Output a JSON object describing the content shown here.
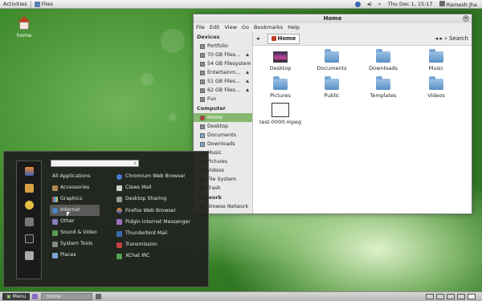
{
  "top_panel": {
    "activities": "Activities",
    "app_label": "Files",
    "clock": "Thu Dec  1, 15:17",
    "user": "Ramesh Jha"
  },
  "desktop": {
    "home_label": "home"
  },
  "file_manager": {
    "title": "Home",
    "menu": [
      "File",
      "Edit",
      "View",
      "Go",
      "Bookmarks",
      "Help"
    ],
    "path_button": "Home",
    "search_label": "Search",
    "sidebar": {
      "devices_header": "Devices",
      "devices": [
        "Portfolio",
        "70 GB Files...",
        "54 GB Filesystem",
        "Entertainm...",
        "51 GB Files...",
        "62 GB Files...",
        "Fun"
      ],
      "computer_header": "Computer",
      "computer": [
        "Home",
        "Desktop",
        "Documents",
        "Downloads",
        "Music",
        "Pictures",
        "Videos",
        "File System",
        "Trash"
      ],
      "network_header": "Network",
      "network": [
        "Browse Network"
      ]
    },
    "files": [
      "Desktop",
      "Documents",
      "Downloads",
      "Music",
      "Pictures",
      "Public",
      "Templates",
      "Videos",
      "test-0000.mpeg"
    ]
  },
  "menu": {
    "categories": [
      "All Applications",
      "Accessories",
      "Graphics",
      "Internet",
      "Other",
      "Sound & Video",
      "System Tools",
      "Places"
    ],
    "active_category": "Internet",
    "apps": [
      "Chromium Web Browser",
      "Claws Mail",
      "Desktop Sharing",
      "Firefox Web Browser",
      "Pidgin Internet Messenger",
      "Thunderbird Mail",
      "Transmission",
      "XChat IRC"
    ]
  },
  "bottom_panel": {
    "menu_button": "Menu",
    "task_label": "Home"
  },
  "colors": {
    "selection": "#86b96f",
    "menu_bg": "#20221e",
    "wallpaper": "#4b9a37"
  }
}
